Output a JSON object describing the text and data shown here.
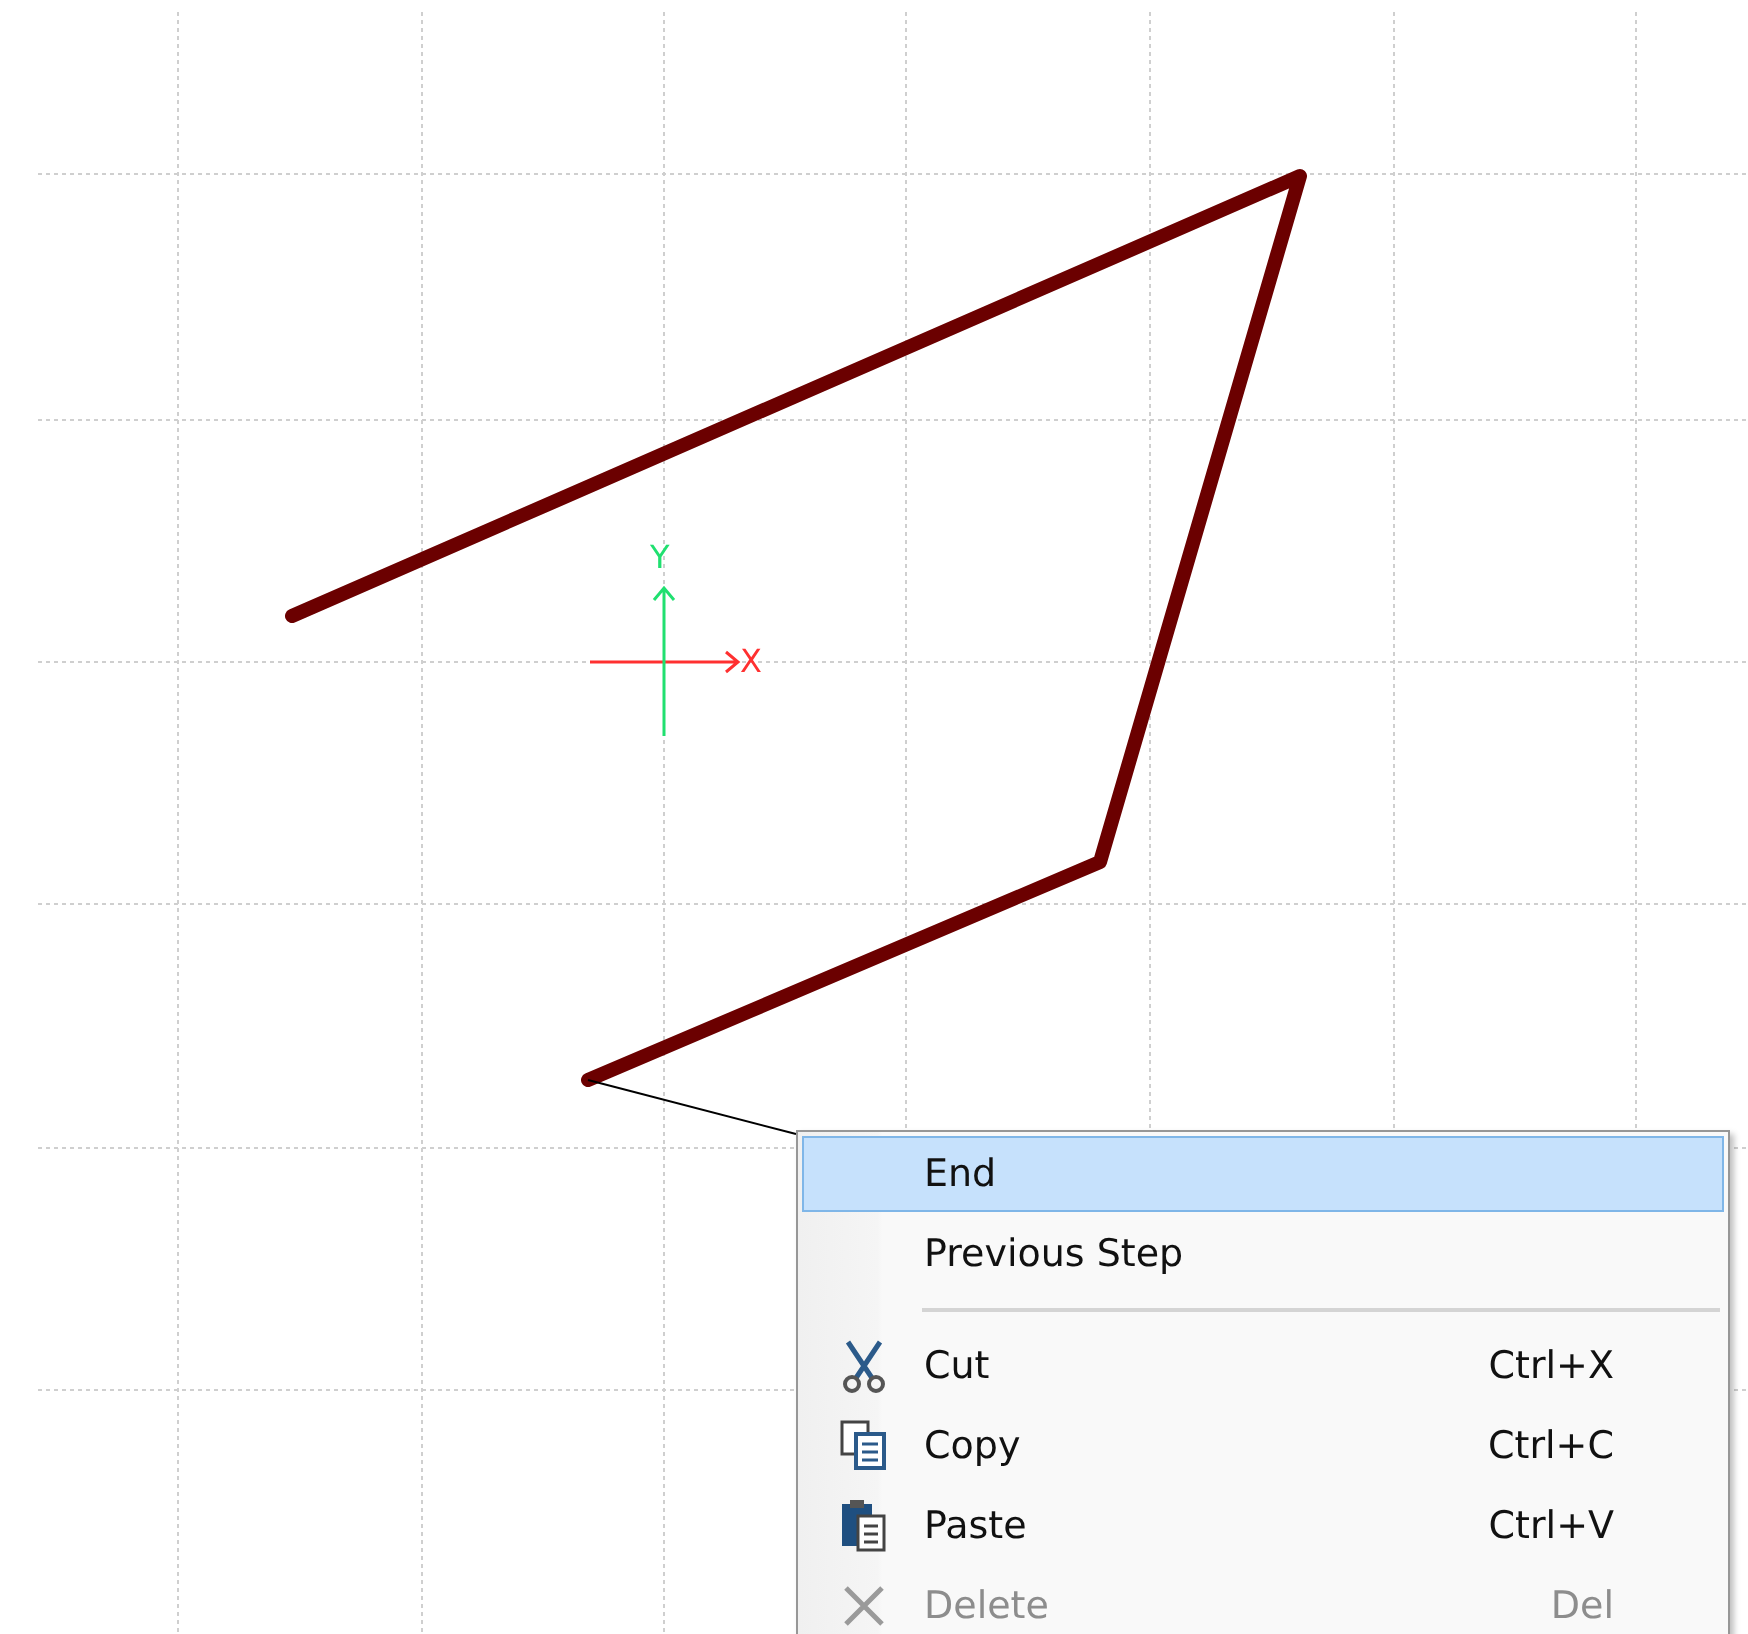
{
  "axes": {
    "x_label": "X",
    "y_label": "Y"
  },
  "context_menu": {
    "items": [
      {
        "kind": "command",
        "label": "End",
        "selected": true,
        "disabled": false
      },
      {
        "kind": "command",
        "label": "Previous Step",
        "selected": false,
        "disabled": false
      },
      {
        "kind": "separator"
      },
      {
        "kind": "command",
        "label": "Cut",
        "shortcut": "Ctrl+X",
        "selected": false,
        "disabled": false
      },
      {
        "kind": "command",
        "label": "Copy",
        "shortcut": "Ctrl+C",
        "selected": false,
        "disabled": false
      },
      {
        "kind": "command",
        "label": "Paste",
        "shortcut": "Ctrl+V",
        "selected": false,
        "disabled": false
      },
      {
        "kind": "command",
        "label": "Delete",
        "shortcut": "Del",
        "selected": false,
        "disabled": true
      }
    ]
  }
}
